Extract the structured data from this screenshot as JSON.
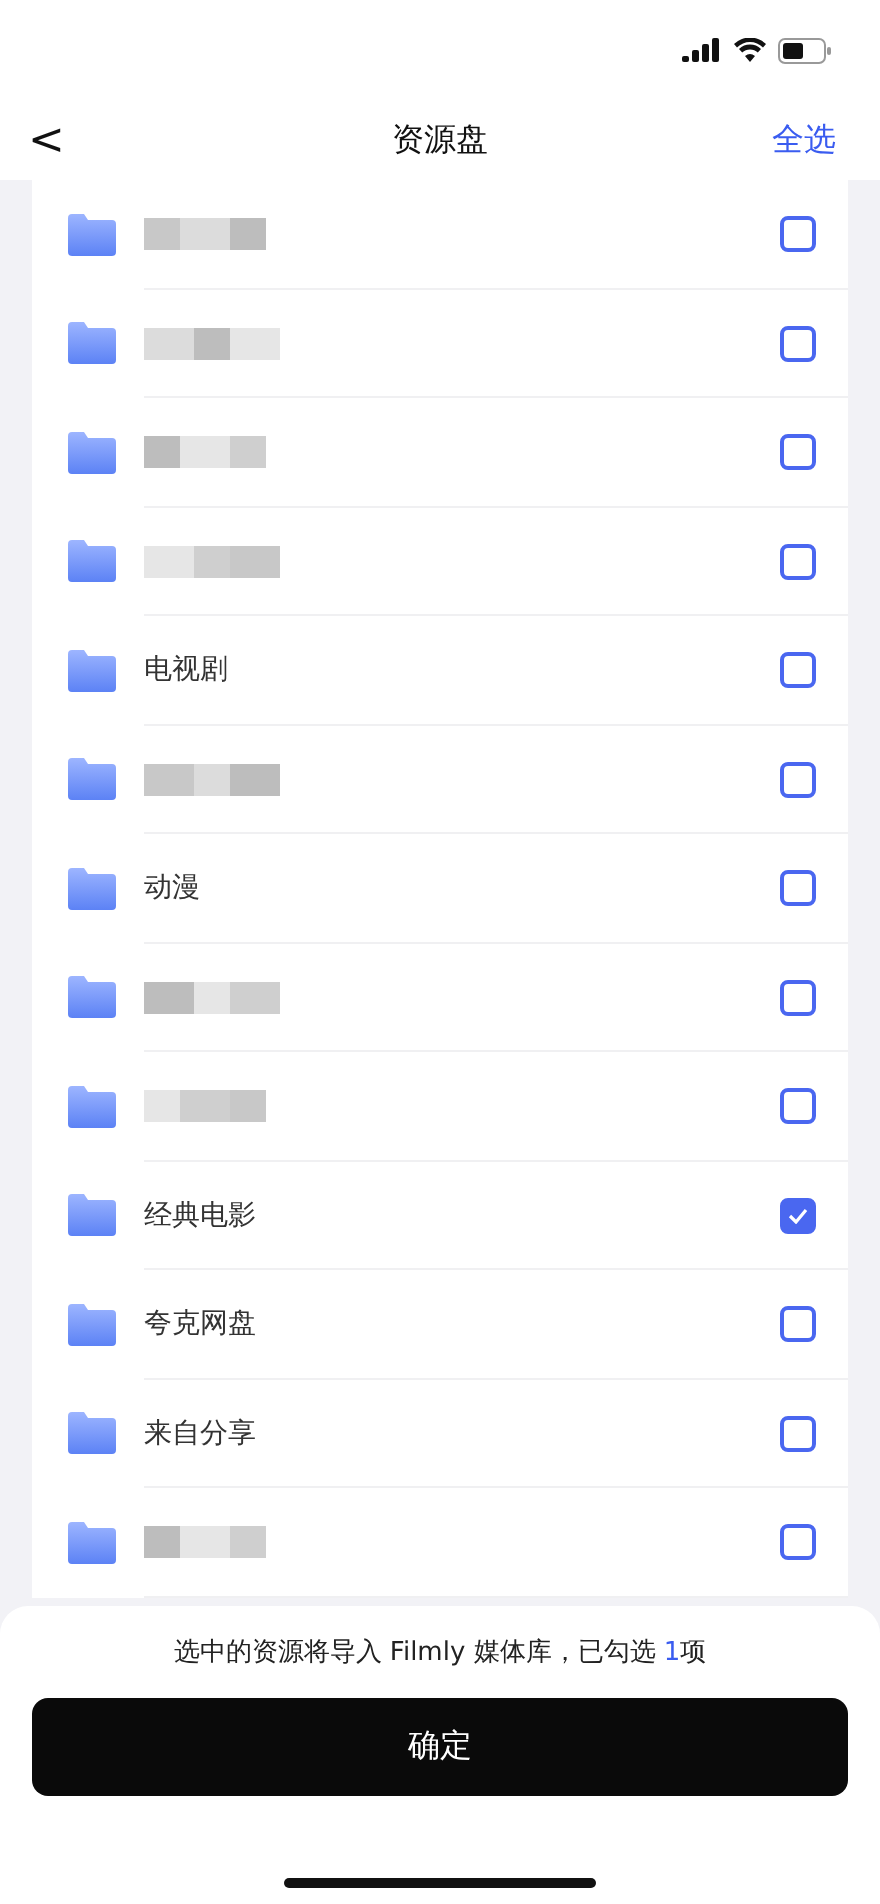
{
  "nav": {
    "back": "<",
    "title": "资源盘",
    "action": "全选"
  },
  "folders": [
    {
      "kind": "redacted",
      "checked": false
    },
    {
      "kind": "redacted",
      "checked": false
    },
    {
      "kind": "redacted",
      "checked": false
    },
    {
      "kind": "redacted",
      "checked": false
    },
    {
      "kind": "named",
      "name": "电视剧",
      "checked": false
    },
    {
      "kind": "redacted",
      "checked": false
    },
    {
      "kind": "named",
      "name": "动漫",
      "checked": false
    },
    {
      "kind": "redacted",
      "checked": false
    },
    {
      "kind": "redacted",
      "checked": false
    },
    {
      "kind": "named",
      "name": "经典电影",
      "checked": true
    },
    {
      "kind": "named",
      "name": "夸克网盘",
      "checked": false
    },
    {
      "kind": "named",
      "name": "来自分享",
      "checked": false
    },
    {
      "kind": "redacted",
      "checked": false
    }
  ],
  "summary": {
    "before": "选中的资源将导入 Filmly 媒体库，已勾选 ",
    "count": "1",
    "after": "项"
  },
  "confirm": "确定"
}
